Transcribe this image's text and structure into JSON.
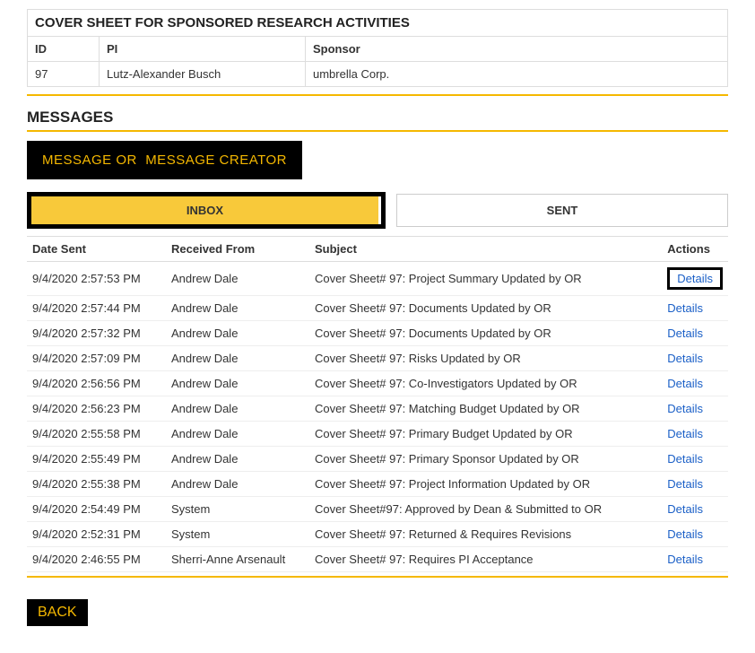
{
  "cover": {
    "title": "COVER SHEET FOR SPONSORED RESEARCH ACTIVITIES",
    "headers": {
      "id": "ID",
      "pi": "PI",
      "sponsor": "Sponsor"
    },
    "row": {
      "id": "97",
      "pi": "Lutz-Alexander Busch",
      "sponsor": "umbrella Corp."
    }
  },
  "messages": {
    "heading": "MESSAGES",
    "create_button": "MESSAGE OR  MESSAGE CREATOR",
    "tabs": {
      "inbox": "INBOX",
      "sent": "SENT"
    },
    "columns": {
      "date": "Date Sent",
      "from": "Received From",
      "subject": "Subject",
      "actions": "Actions"
    },
    "details_label": "Details",
    "rows": [
      {
        "date": "9/4/2020 2:57:53 PM",
        "from": "Andrew Dale",
        "subject": "Cover Sheet# 97: Project Summary Updated by OR",
        "highlight": true
      },
      {
        "date": "9/4/2020 2:57:44 PM",
        "from": "Andrew Dale",
        "subject": "Cover Sheet# 97: Documents Updated by OR",
        "highlight": false
      },
      {
        "date": "9/4/2020 2:57:32 PM",
        "from": "Andrew Dale",
        "subject": "Cover Sheet# 97: Documents Updated by OR",
        "highlight": false
      },
      {
        "date": "9/4/2020 2:57:09 PM",
        "from": "Andrew Dale",
        "subject": "Cover Sheet# 97: Risks Updated by OR",
        "highlight": false
      },
      {
        "date": "9/4/2020 2:56:56 PM",
        "from": "Andrew Dale",
        "subject": "Cover Sheet# 97: Co-Investigators Updated by OR",
        "highlight": false
      },
      {
        "date": "9/4/2020 2:56:23 PM",
        "from": "Andrew Dale",
        "subject": "Cover Sheet# 97: Matching Budget Updated by OR",
        "highlight": false
      },
      {
        "date": "9/4/2020 2:55:58 PM",
        "from": "Andrew Dale",
        "subject": "Cover Sheet# 97: Primary Budget Updated by OR",
        "highlight": false
      },
      {
        "date": "9/4/2020 2:55:49 PM",
        "from": "Andrew Dale",
        "subject": "Cover Sheet# 97: Primary Sponsor Updated by OR",
        "highlight": false
      },
      {
        "date": "9/4/2020 2:55:38 PM",
        "from": "Andrew Dale",
        "subject": "Cover Sheet# 97: Project Information Updated by OR",
        "highlight": false
      },
      {
        "date": "9/4/2020 2:54:49 PM",
        "from": "System",
        "subject": "Cover Sheet#97: Approved by Dean & Submitted to OR",
        "highlight": false
      },
      {
        "date": "9/4/2020 2:52:31 PM",
        "from": "System",
        "subject": "Cover Sheet# 97: Returned & Requires Revisions",
        "highlight": false
      },
      {
        "date": "9/4/2020 2:46:55 PM",
        "from": "Sherri-Anne Arsenault",
        "subject": "Cover Sheet# 97: Requires PI Acceptance",
        "highlight": false
      }
    ]
  },
  "back_label": "BACK"
}
